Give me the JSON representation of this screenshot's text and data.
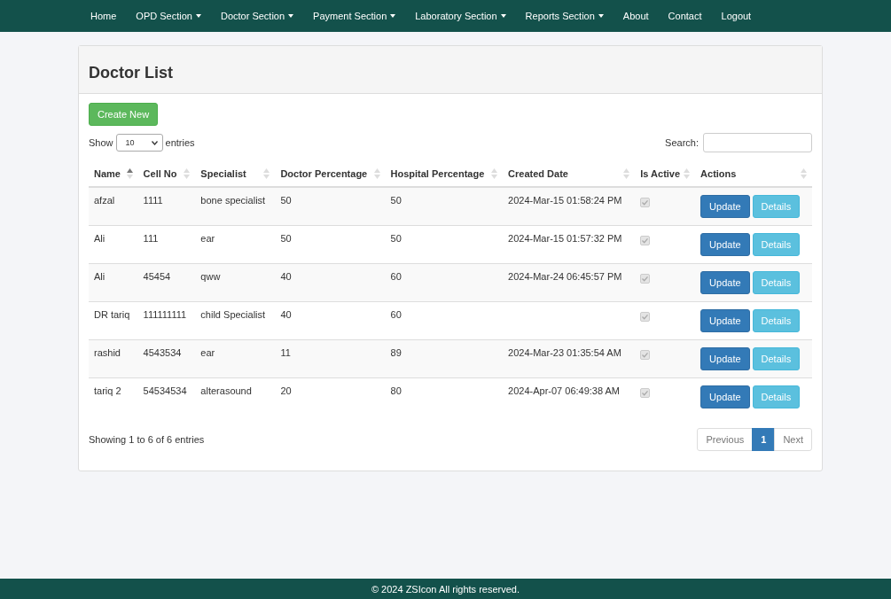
{
  "nav": [
    {
      "label": "Home",
      "dropdown": false
    },
    {
      "label": "OPD Section",
      "dropdown": true
    },
    {
      "label": "Doctor Section",
      "dropdown": true
    },
    {
      "label": "Payment Section",
      "dropdown": true
    },
    {
      "label": "Laboratory Section",
      "dropdown": true
    },
    {
      "label": "Reports Section",
      "dropdown": true
    },
    {
      "label": "About",
      "dropdown": false
    },
    {
      "label": "Contact",
      "dropdown": false
    },
    {
      "label": "Logout",
      "dropdown": false
    }
  ],
  "panel": {
    "title": "Doctor List",
    "create_button": "Create New",
    "length": {
      "show": "Show",
      "value": "10",
      "entries": "entries"
    },
    "search": {
      "label": "Search:"
    },
    "table": {
      "columns": [
        {
          "label": "Name",
          "sorted": true
        },
        {
          "label": "Cell No",
          "sorted": false
        },
        {
          "label": "Specialist",
          "sorted": false
        },
        {
          "label": "Doctor Percentage",
          "sorted": false
        },
        {
          "label": "Hospital Percentage",
          "sorted": false
        },
        {
          "label": "Created Date",
          "sorted": false
        },
        {
          "label": "Is Active",
          "sorted": false
        },
        {
          "label": "Actions",
          "sorted": false
        }
      ],
      "rows": [
        {
          "name": "afzal",
          "cell_no": "1111",
          "specialist": "bone specialist",
          "doctor_percentage": "50",
          "hospital_percentage": "50",
          "created_date": "2024-Mar-15 01:58:24 PM",
          "active": true,
          "update": "Update",
          "details": "Details"
        },
        {
          "name": "Ali",
          "cell_no": "111",
          "specialist": "ear",
          "doctor_percentage": "50",
          "hospital_percentage": "50",
          "created_date": "2024-Mar-15 01:57:32 PM",
          "active": true,
          "update": "Update",
          "details": "Details"
        },
        {
          "name": "Ali",
          "cell_no": "45454",
          "specialist": "qww",
          "doctor_percentage": "40",
          "hospital_percentage": "60",
          "created_date": "2024-Mar-24 06:45:57 PM",
          "active": true,
          "update": "Update",
          "details": "Details"
        },
        {
          "name": "DR tariq",
          "cell_no": "111111111",
          "specialist": "child Specialist",
          "doctor_percentage": "40",
          "hospital_percentage": "60",
          "active": true,
          "update": "Update",
          "details": "Details"
        },
        {
          "name": "rashid",
          "cell_no": "4543534",
          "specialist": "ear",
          "doctor_percentage": "11",
          "hospital_percentage": "89",
          "created_date": "2024-Mar-23 01:35:54 AM",
          "active": true,
          "update": "Update",
          "details": "Details"
        },
        {
          "name": "tariq 2",
          "cell_no": "54534534",
          "specialist": "alterasound",
          "doctor_percentage": "20",
          "hospital_percentage": "80",
          "created_date": "2024-Apr-07 06:49:38 AM",
          "active": true,
          "update": "Update",
          "details": "Details"
        }
      ]
    },
    "info": "Showing 1 to 6 of 6 entries",
    "pagination": {
      "previous": {
        "label": "Previous",
        "disabled": true
      },
      "pages": [
        {
          "label": "1",
          "selected": true
        }
      ],
      "next": {
        "label": "Next",
        "disabled": true
      }
    }
  },
  "footer": "© 2024 ZSIcon All rights reserved."
}
